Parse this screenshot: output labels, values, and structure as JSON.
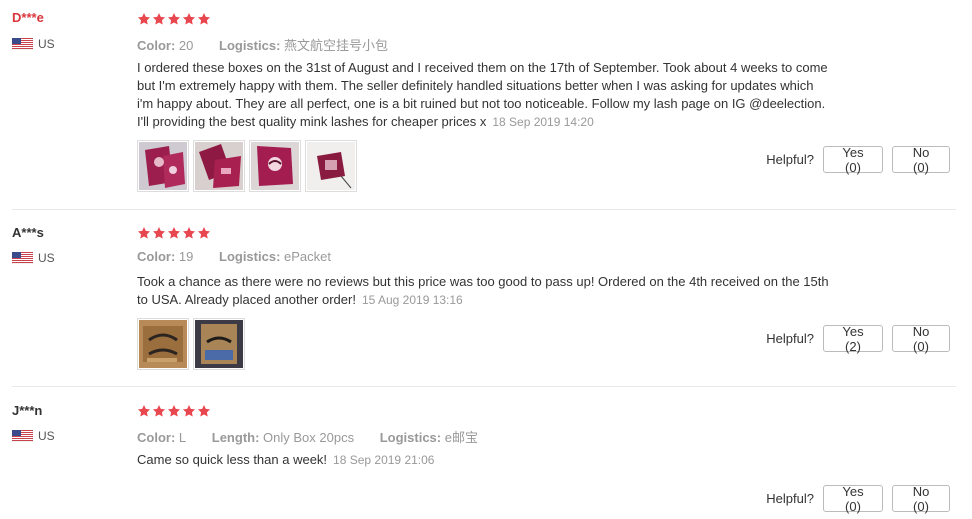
{
  "reviews": [
    {
      "user": "D***e",
      "country": "US",
      "rating": 5,
      "meta": [
        {
          "key": "Color:",
          "value": "20"
        },
        {
          "key": "Logistics:",
          "value": "燕文航空挂号小包"
        }
      ],
      "text_lines": [
        "I ordered these boxes on the 31st of August and I received them on the 17th of September. Took about 4 weeks to come",
        "but I'm extremely happy with them. The seller definitely handled situations better when I was asking for updates which",
        "i'm happy about. They are all perfect, one is a bit ruined but not too noticeable. Follow my lash page on IG @deelection.",
        "I'll providing the best quality mink lashes for cheaper prices x"
      ],
      "date": "18 Sep 2019 14:20",
      "photo_count": 4,
      "helpful_label": "Helpful?",
      "yes_label": "Yes (0)",
      "no_label": "No (0)"
    },
    {
      "user": "A***s",
      "country": "US",
      "rating": 5,
      "meta": [
        {
          "key": "Color:",
          "value": "19"
        },
        {
          "key": "Logistics:",
          "value": "ePacket"
        }
      ],
      "text_lines": [
        "Took a chance as there were no reviews but this price was too good to pass up! Ordered on the 4th received on the 15th",
        "to USA. Already placed another order!"
      ],
      "date": "15 Aug 2019 13:16",
      "photo_count": 2,
      "helpful_label": "Helpful?",
      "yes_label": "Yes (2)",
      "no_label": "No (0)"
    },
    {
      "user": "J***n",
      "country": "US",
      "rating": 5,
      "meta": [
        {
          "key": "Color:",
          "value": "L"
        },
        {
          "key": "Length:",
          "value": "Only Box 20pcs"
        },
        {
          "key": "Logistics:",
          "value": "e邮宝"
        }
      ],
      "text_lines": [
        "Came so quick less than a week!"
      ],
      "date": "18 Sep 2019 21:06",
      "photo_count": 0,
      "helpful_label": "Helpful?",
      "yes_label": "Yes (0)",
      "no_label": "No (0)"
    }
  ],
  "colors": {
    "star": "#e9474f",
    "username_highlight": "#d9363e",
    "muted": "#999999"
  }
}
